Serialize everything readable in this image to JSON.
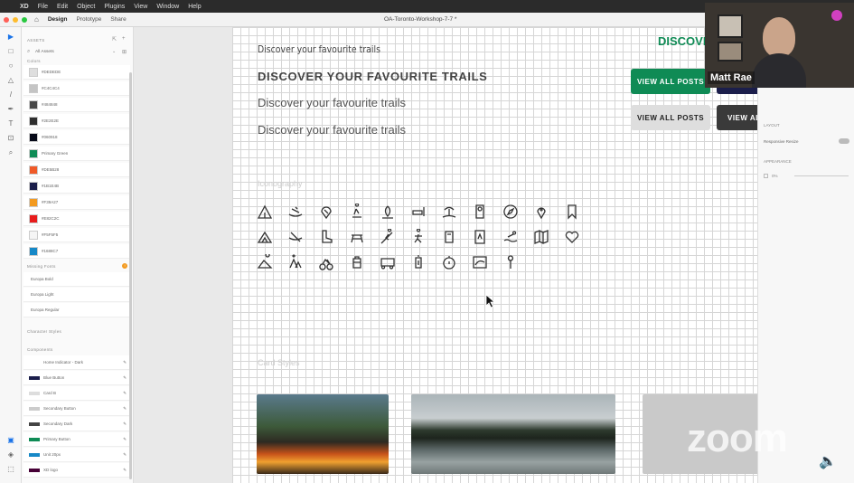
{
  "menubar": {
    "app": "XD",
    "items": [
      "File",
      "Edit",
      "Object",
      "Plugins",
      "View",
      "Window",
      "Help"
    ]
  },
  "titlebar": {
    "tabs": [
      "Design",
      "Prototype",
      "Share"
    ],
    "doc_title": "OA-Toronto-Workshop-7-7 *"
  },
  "assets": {
    "title": "ASSETS",
    "filter": "All Assets",
    "colors_label": "Colors",
    "colors": [
      {
        "name": "#DEDEDE",
        "hex": "#DEDEDE"
      },
      {
        "name": "#C4C4C4",
        "hex": "#C4C4C4"
      },
      {
        "name": "#484848",
        "hex": "#484848"
      },
      {
        "name": "#2E2E2E",
        "hex": "#2E2E2E"
      },
      {
        "name": "#060918",
        "hex": "#060918"
      },
      {
        "name": "Primary Green",
        "hex": "#0F8B55"
      },
      {
        "name": "#DE5B28",
        "hex": "#F05A28"
      },
      {
        "name": "#1B1E4B",
        "hex": "#1B1E4B"
      },
      {
        "name": "#F39A27",
        "hex": "#F39A1F"
      },
      {
        "name": "#E82C2C",
        "hex": "#E81C1C"
      },
      {
        "name": "#F5F5F5",
        "hex": "#F5F5F5"
      },
      {
        "name": "#1688C7",
        "hex": "#1688C7"
      }
    ],
    "missing_fonts_label": "Missing Fonts",
    "fonts": [
      "Europa Bold",
      "Europa Light",
      "Europa Regular"
    ],
    "char_styles_label": "Character Styles",
    "components_label": "Components",
    "components": [
      {
        "name": "Home Indicator - Dark",
        "hex": "#ffffff"
      },
      {
        "name": "Blue Button",
        "hex": "#1B1E4B"
      },
      {
        "name": "Card B",
        "hex": "#dddddd"
      },
      {
        "name": "Secondary Button",
        "hex": "#cccccc"
      },
      {
        "name": "Secondary Dark",
        "hex": "#444444"
      },
      {
        "name": "Primary Button",
        "hex": "#0F8B55"
      },
      {
        "name": "Unit 20px",
        "hex": "#1688C7"
      },
      {
        "name": "XD logo",
        "hex": "#470137"
      }
    ]
  },
  "artboard": {
    "heading_small": "Discover your favourite trails",
    "heading_caps": "DISCOVER YOUR FAVOURITE TRAILS",
    "heading_med": "Discover your favourite trails",
    "heading_large": "Discover your favourite trails",
    "discover_green": "DISCOVE",
    "btn_primary": "VIEW ALL POSTS",
    "btn_secondary": "VIEW ALL POSTS",
    "btn_dark": "VIEW AL",
    "iconography_label": "Iconography",
    "card_styles_label": "Card Styles",
    "colors": {
      "green": "#0F8B55",
      "navy": "#1B1E4B",
      "grey": "#DEDEDE",
      "dark": "#3a3a3a"
    }
  },
  "inspector": {
    "layout_label": "LAYOUT",
    "responsive_label": "Responsive Resize",
    "appearance_label": "APPEARANCE",
    "opacity": "0%"
  },
  "webcam": {
    "name": "Matt Rae"
  },
  "zoom_logo": "zoom"
}
